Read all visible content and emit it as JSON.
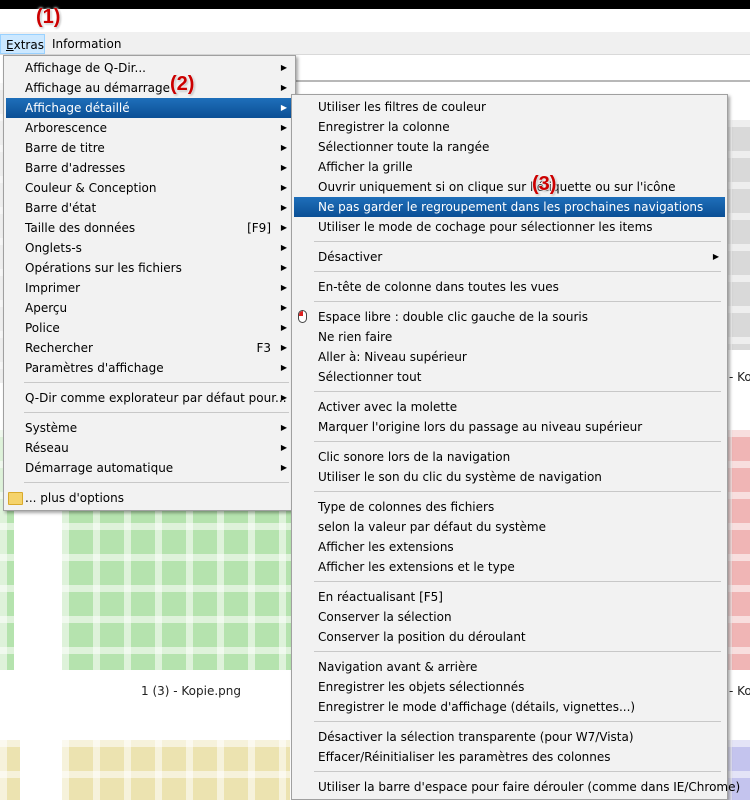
{
  "menubar": {
    "items": [
      {
        "label": "Extras",
        "mnemonic": "E",
        "rest": "xtras"
      },
      {
        "label": "Information"
      }
    ]
  },
  "callouts": [
    "(1)",
    "(2)",
    "(3)"
  ],
  "file_labels": [
    "1 (3) - Kopie.png",
    "- Ko",
    "- Ko"
  ],
  "extras_menu": {
    "items": [
      {
        "label": "Affichage de Q-Dir...",
        "shortcut": "",
        "submenu": true
      },
      {
        "label": "Affichage au démarrage",
        "shortcut": "",
        "submenu": true
      },
      {
        "label": "Affichage détaillé",
        "shortcut": "",
        "submenu": true,
        "highlighted": true
      },
      {
        "label": "Arborescence",
        "shortcut": "",
        "submenu": true
      },
      {
        "label": "Barre de titre",
        "shortcut": "",
        "submenu": true
      },
      {
        "label": "Barre d'adresses",
        "shortcut": "",
        "submenu": true
      },
      {
        "label": "Couleur & Conception",
        "shortcut": "",
        "submenu": true
      },
      {
        "label": "Barre d'état",
        "shortcut": "",
        "submenu": true
      },
      {
        "label": "Taille des données",
        "shortcut": "[F9]",
        "submenu": true
      },
      {
        "label": "Onglets-s",
        "shortcut": "",
        "submenu": true
      },
      {
        "label": "Opérations sur les fichiers",
        "shortcut": "",
        "submenu": true
      },
      {
        "label": "Imprimer",
        "shortcut": "",
        "submenu": true
      },
      {
        "label": "Aperçu",
        "shortcut": "",
        "submenu": true
      },
      {
        "label": "Police",
        "shortcut": "",
        "submenu": true
      },
      {
        "label": "Rechercher",
        "shortcut": "F3",
        "submenu": true
      },
      {
        "label": "Paramètres d'affichage",
        "shortcut": "",
        "submenu": true
      },
      {
        "label": "Q-Dir comme explorateur par défaut pour...",
        "shortcut": "",
        "submenu": true
      },
      {
        "label": "Système",
        "shortcut": "",
        "submenu": true
      },
      {
        "label": "Réseau",
        "shortcut": "",
        "submenu": true
      },
      {
        "label": "Démarrage automatique",
        "shortcut": "",
        "submenu": true
      },
      {
        "label": "... plus d'options",
        "shortcut": "",
        "submenu": false
      }
    ]
  },
  "detail_submenu": {
    "items": [
      {
        "label": "Utiliser les filtres de couleur"
      },
      {
        "label": "Enregistrer la colonne"
      },
      {
        "label": "Sélectionner toute la rangée"
      },
      {
        "label": "Afficher la grille"
      },
      {
        "label": "Ouvrir uniquement si on clique sur l'étiquette ou sur l'icône"
      },
      {
        "label": "Ne pas garder le regroupement dans les prochaines navigations",
        "highlighted": true
      },
      {
        "label": "Utiliser le mode de cochage pour sélectionner les items"
      },
      {
        "label": "Désactiver",
        "submenu": true
      },
      {
        "label": "En-tête de colonne dans toutes les vues"
      },
      {
        "label": "Espace libre : double clic gauche de la souris",
        "icon": "mouse-icon"
      },
      {
        "label": "Ne rien faire"
      },
      {
        "label": "Aller à: Niveau supérieur"
      },
      {
        "label": "Sélectionner tout"
      },
      {
        "label": "Activer avec la molette"
      },
      {
        "label": "Marquer l'origine lors du passage au niveau supérieur"
      },
      {
        "label": "Clic sonore lors de la navigation"
      },
      {
        "label": "Utiliser le son du clic du système de navigation"
      },
      {
        "label": "Type de colonnes des fichiers"
      },
      {
        "label": "selon la valeur par défaut du système"
      },
      {
        "label": "Afficher les extensions"
      },
      {
        "label": "Afficher les extensions et le type"
      },
      {
        "label": "En réactualisant [F5]"
      },
      {
        "label": "Conserver la sélection"
      },
      {
        "label": "Conserver la position du déroulant"
      },
      {
        "label": "Navigation avant & arrière"
      },
      {
        "label": "Enregistrer les objets sélectionnés"
      },
      {
        "label": "Enregistrer le mode d'affichage (détails, vignettes...)"
      },
      {
        "label": "Désactiver la sélection transparente (pour W7/Vista)"
      },
      {
        "label": "Effacer/Réinitialiser les paramètres des colonnes"
      },
      {
        "label": "Utiliser la barre d'espace pour faire dérouler (comme dans IE/Chrome)"
      }
    ]
  },
  "colors": {
    "highlight": "#0b4f95",
    "callout": "#cc0000",
    "thumb_green": "#b5e3ae",
    "thumb_gray": "#d9d9d9",
    "thumb_red": "#f0b5b5",
    "thumb_yellow": "#ece3b0",
    "thumb_blue": "#c4c4ee"
  }
}
